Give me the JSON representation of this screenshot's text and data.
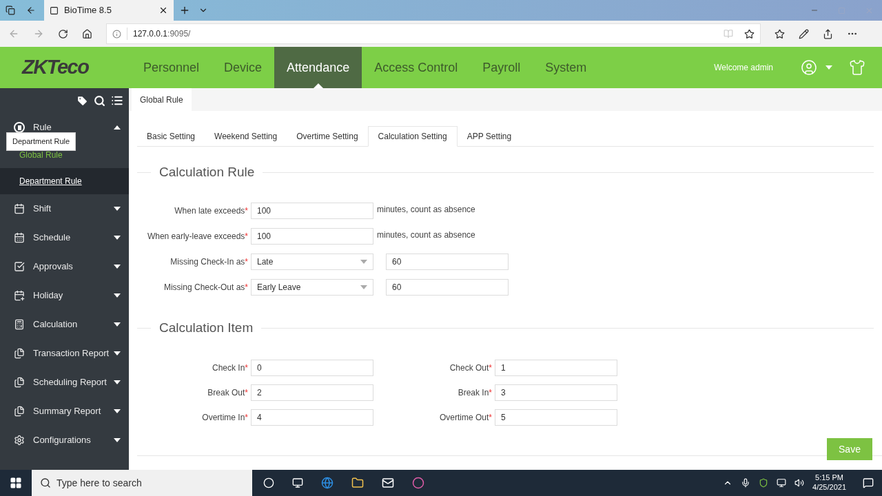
{
  "browser": {
    "tab_title": "BioTime 8.5",
    "address": "127.0.0.1",
    "address_port": ":9095/"
  },
  "header": {
    "logo": "ZKTeco",
    "welcome": "Welcome admin",
    "nav": [
      {
        "label": "Personnel",
        "selected": false
      },
      {
        "label": "Device",
        "selected": false
      },
      {
        "label": "Attendance",
        "selected": true
      },
      {
        "label": "Access Control",
        "selected": false
      },
      {
        "label": "Payroll",
        "selected": false
      },
      {
        "label": "System",
        "selected": false
      }
    ]
  },
  "sidebar": {
    "tooltip": "Department Rule",
    "items": [
      {
        "label": "Rule",
        "expanded": true,
        "children": [
          {
            "label": "Global Rule",
            "selected": true,
            "hovered": false
          },
          {
            "label": "Department Rule",
            "selected": false,
            "hovered": true
          }
        ]
      },
      {
        "label": "Shift",
        "expanded": false
      },
      {
        "label": "Schedule",
        "expanded": false
      },
      {
        "label": "Approvals",
        "expanded": false
      },
      {
        "label": "Holiday",
        "expanded": false
      },
      {
        "label": "Calculation",
        "expanded": false
      },
      {
        "label": "Transaction Report",
        "expanded": false
      },
      {
        "label": "Scheduling Report",
        "expanded": false
      },
      {
        "label": "Summary Report",
        "expanded": false
      },
      {
        "label": "Configurations",
        "expanded": false
      }
    ]
  },
  "required_mark": "*",
  "page_tab": "Global Rule",
  "tabs": [
    {
      "label": "Basic Setting",
      "selected": false
    },
    {
      "label": "Weekend Setting",
      "selected": false
    },
    {
      "label": "Overtime Setting",
      "selected": false
    },
    {
      "label": "Calculation Setting",
      "selected": true
    },
    {
      "label": "APP Setting",
      "selected": false
    }
  ],
  "calculation_rule": {
    "title": "Calculation Rule",
    "rows": [
      {
        "kind": "input",
        "label": "When late exceeds",
        "value": "100",
        "suffix": "minutes, count as absence"
      },
      {
        "kind": "input",
        "label": "When early-leave exceeds",
        "value": "100",
        "suffix": "minutes, count as absence"
      },
      {
        "kind": "select",
        "label": "Missing Check-In as",
        "value": "Late",
        "extra": "60"
      },
      {
        "kind": "select",
        "label": "Missing Check-Out as",
        "value": "Early Leave",
        "extra": "60"
      }
    ]
  },
  "calculation_item": {
    "title": "Calculation Item",
    "rows": [
      [
        {
          "label": "Check In",
          "value": "0"
        },
        {
          "label": "Check Out",
          "value": "1"
        }
      ],
      [
        {
          "label": "Break Out",
          "value": "2"
        },
        {
          "label": "Break In",
          "value": "3"
        }
      ],
      [
        {
          "label": "Overtime In",
          "value": "4"
        },
        {
          "label": "Overtime Out",
          "value": "5"
        }
      ]
    ]
  },
  "save_button": "Save",
  "taskbar": {
    "search_placeholder": "Type here to search",
    "time": "5:15 PM",
    "date": "4/25/2021"
  }
}
